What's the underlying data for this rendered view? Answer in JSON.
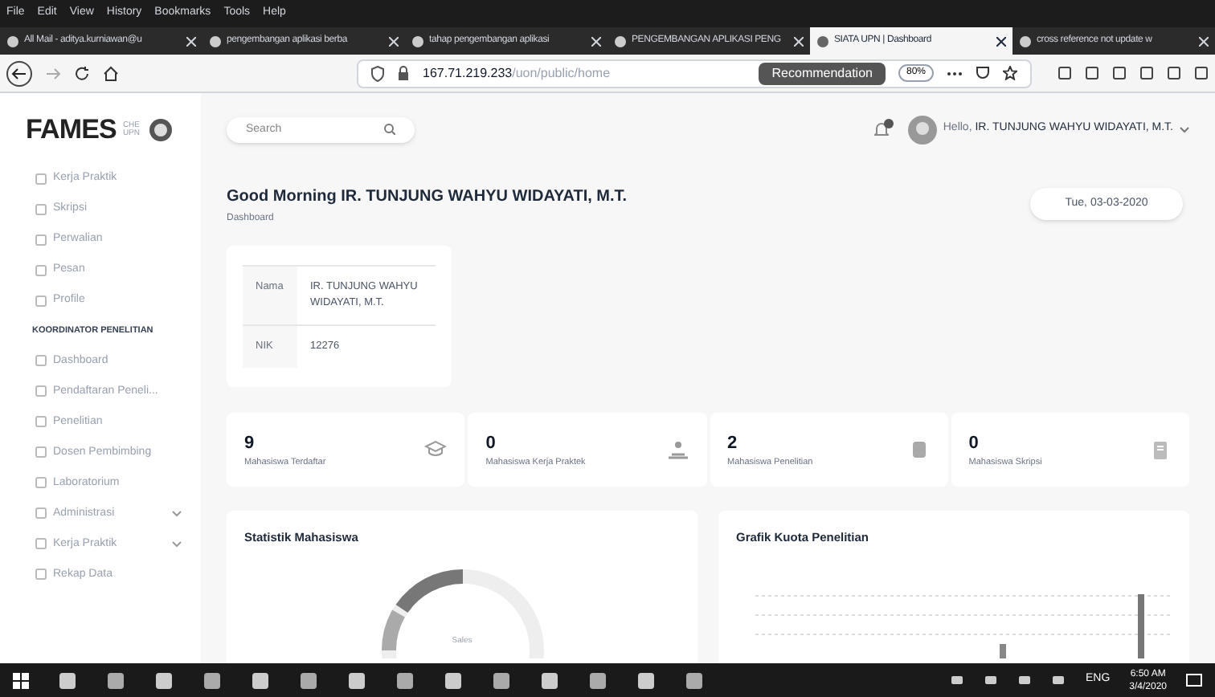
{
  "browser": {
    "menu": [
      "File",
      "Edit",
      "View",
      "History",
      "Bookmarks",
      "Tools",
      "Help"
    ],
    "tabs": [
      {
        "title": "All Mail - aditya.kurniawan@u",
        "selected": false
      },
      {
        "title": "pengembangan aplikasi berba",
        "selected": false
      },
      {
        "title": "tahap pengembangan aplikasi",
        "selected": false
      },
      {
        "title": "PENGEMBANGAN APLIKASI PENG",
        "selected": false
      },
      {
        "title": "SIATA UPN | Dashboard",
        "selected": true
      },
      {
        "title": "cross reference not update w",
        "selected": false
      }
    ],
    "address": {
      "host": "167.71.219.233",
      "path": "/uon/public/home"
    },
    "recommendation": "Recommendation",
    "zoom": "80%"
  },
  "header": {
    "logo": "FAMES",
    "logo_sub": "CHE UPN",
    "search": {
      "placeholder": "Search"
    },
    "greeting": "Hello,",
    "user": "IR. TUNJUNG WAHYU WIDAYATI, M.T."
  },
  "sidebar": [
    {
      "kind": "item",
      "label": "Kerja Praktik",
      "expandable": false
    },
    {
      "kind": "item",
      "label": "Skripsi",
      "expandable": false
    },
    {
      "kind": "item",
      "label": "Perwalian",
      "expandable": false
    },
    {
      "kind": "item",
      "label": "Pesan",
      "expandable": false
    },
    {
      "kind": "item",
      "label": "Profile",
      "expandable": false
    },
    {
      "kind": "heading",
      "label": "KOORDINATOR PENELITIAN"
    },
    {
      "kind": "item",
      "label": "Dashboard",
      "expandable": false
    },
    {
      "kind": "item",
      "label": "Pendaftaran Peneli...",
      "expandable": false
    },
    {
      "kind": "item",
      "label": "Penelitian",
      "expandable": false
    },
    {
      "kind": "item",
      "label": "Dosen Pembimbing",
      "expandable": false
    },
    {
      "kind": "item",
      "label": "Laboratorium",
      "expandable": false
    },
    {
      "kind": "item",
      "label": "Administrasi",
      "expandable": true
    },
    {
      "kind": "item",
      "label": "Kerja Praktik",
      "expandable": true
    },
    {
      "kind": "item",
      "label": "Rekap Data",
      "expandable": false
    }
  ],
  "main": {
    "title": "Good Morning IR. TUNJUNG WAHYU WIDAYATI, M.T.",
    "breadcrumb": "Dashboard",
    "date": "Tue, 03-03-2020",
    "profile": [
      {
        "label": "Nama",
        "value": "IR. TUNJUNG WAHYU WIDAYATI, M.T."
      },
      {
        "label": "NIK",
        "value": "12276"
      }
    ],
    "stats": [
      {
        "value": "9",
        "label": "Mahasiswa Terdaftar"
      },
      {
        "value": "0",
        "label": "Mahasiswa Kerja Praktek"
      },
      {
        "value": "2",
        "label": "Mahasiswa Penelitian"
      },
      {
        "value": "0",
        "label": "Mahasiswa Skripsi"
      }
    ],
    "panels": [
      {
        "kind": "donut",
        "title": "Statistik Mahasiswa",
        "center_label": "Sales"
      },
      {
        "kind": "bars",
        "title": "Grafik Kuota Penelitian"
      }
    ]
  },
  "taskbar": {
    "language": "ENG",
    "time": "6:50 AM",
    "date": "3/4/2020"
  }
}
